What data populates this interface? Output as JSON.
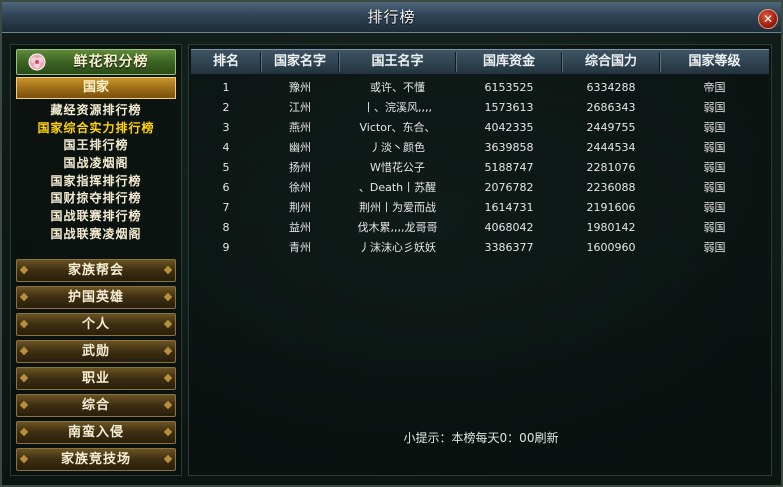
{
  "window": {
    "title": "排行榜",
    "close_label": "✕"
  },
  "sidebar": {
    "flower_label": "鲜花积分榜",
    "country_label": "国家",
    "sub_items": [
      "藏经资源排行榜",
      "国家综合实力排行榜",
      "国王排行榜",
      "国战凌烟阁",
      "国家指挥排行榜",
      "国财掠夺排行榜",
      "国战联赛排行榜",
      "国战联赛凌烟阁"
    ],
    "active_sub_index": 1,
    "sections": [
      "家族帮会",
      "护国英雄",
      "个人",
      "武勋",
      "职业",
      "综合",
      "南蛮入侵",
      "家族竞技场"
    ]
  },
  "table": {
    "headers": [
      "排名",
      "国家名字",
      "国王名字",
      "国库资金",
      "综合国力",
      "国家等级"
    ],
    "rows": [
      [
        "1",
        "豫州",
        "或许、不懂",
        "6153525",
        "6334288",
        "帝国"
      ],
      [
        "2",
        "江州",
        "丨、浣溪风,,,,",
        "1573613",
        "2686343",
        "弱国"
      ],
      [
        "3",
        "燕州",
        "Victor、东合、",
        "4042335",
        "2449755",
        "弱国"
      ],
      [
        "4",
        "幽州",
        "丿淡丶颜色",
        "3639858",
        "2444534",
        "弱国"
      ],
      [
        "5",
        "扬州",
        "W惜花公子",
        "5188747",
        "2281076",
        "弱国"
      ],
      [
        "6",
        "徐州",
        "、Death丨苏醒",
        "2076782",
        "2236088",
        "弱国"
      ],
      [
        "7",
        "荆州",
        "荆州丨为爱而战",
        "1614731",
        "2191606",
        "弱国"
      ],
      [
        "8",
        "益州",
        "伐木累,,,,龙哥哥",
        "4068042",
        "1980142",
        "弱国"
      ],
      [
        "9",
        "青州",
        "丿沫沫心彡妖妖",
        "3386377",
        "1600960",
        "弱国"
      ]
    ]
  },
  "tip": "小提示：本榜每天0：00刷新",
  "colors": {
    "active_item": "#ffd200",
    "title_bar": "#2f4456",
    "country_gold": "#9a6a15"
  }
}
